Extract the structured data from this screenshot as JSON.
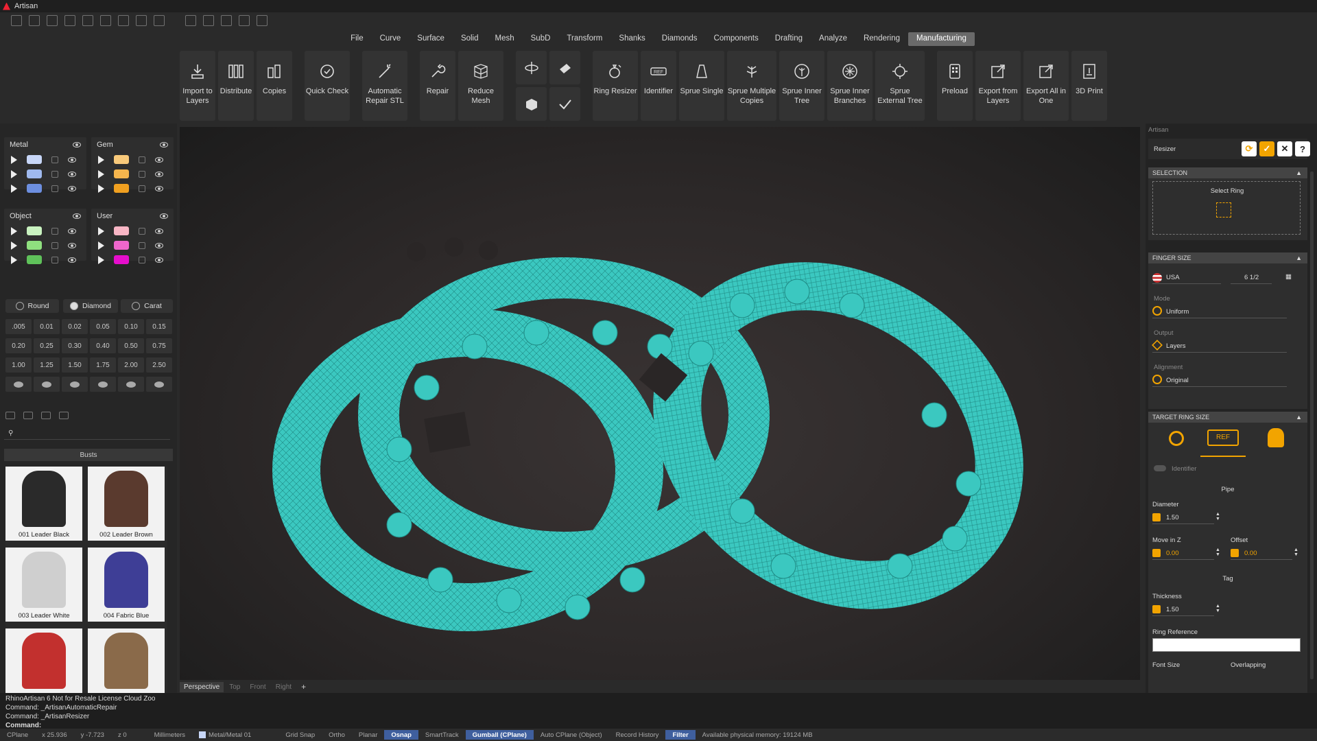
{
  "app": {
    "title": "Artisan"
  },
  "menu": [
    "File",
    "Curve",
    "Surface",
    "Solid",
    "Mesh",
    "SubD",
    "Transform",
    "Shanks",
    "Diamonds",
    "Components",
    "Drafting",
    "Analyze",
    "Rendering",
    "Manufacturing"
  ],
  "menu_active": "Manufacturing",
  "ribbon": {
    "import": "Import to Layers",
    "distribute": "Distribute",
    "copies": "Copies",
    "quick_check": "Quick Check",
    "auto_repair": "Automatic Repair STL",
    "repair": "Repair",
    "reduce_mesh": "Reduce Mesh",
    "ring_resizer": "Ring Resizer",
    "identifier": "Identifier",
    "sprue_single": "Sprue Single",
    "sprue_multiple": "Sprue Multiple Copies",
    "sprue_inner_tree": "Sprue Inner Tree",
    "sprue_inner_branches": "Sprue Inner Branches",
    "sprue_external_tree": "Sprue External Tree",
    "preload": "Preload",
    "export_layers": "Export from Layers",
    "export_all": "Export All in One",
    "print3d": "3D Print"
  },
  "layers": {
    "metal": {
      "label": "Metal",
      "colors": [
        "#c7d6f7",
        "#9fb9ee",
        "#6d8fe0"
      ]
    },
    "gem": {
      "label": "Gem",
      "colors": [
        "#f8c97a",
        "#f5b54d",
        "#f0a020"
      ]
    },
    "object": {
      "label": "Object",
      "colors": [
        "#c9f2c0",
        "#8fe07f",
        "#5fc25a"
      ]
    },
    "user": {
      "label": "User",
      "colors": [
        "#f8b6c5",
        "#ee66cc",
        "#e60ecc"
      ]
    }
  },
  "gems": {
    "round": "Round",
    "diamond": "Diamond",
    "carat": "Carat",
    "sizes": [
      ".005",
      "0.01",
      "0.02",
      "0.05",
      "0.10",
      "0.15",
      "0.20",
      "0.25",
      "0.30",
      "0.40",
      "0.50",
      "0.75",
      "1.00",
      "1.25",
      "1.50",
      "1.75",
      "2.00",
      "2.50"
    ]
  },
  "library": {
    "category": "Busts",
    "items": [
      {
        "label": "001 Leader Black",
        "color": "#2a2a2a"
      },
      {
        "label": "002 Leader Brown",
        "color": "#5a3a2e"
      },
      {
        "label": "003 Leader White",
        "color": "#cfcfcf"
      },
      {
        "label": "004 Fabric Blue",
        "color": "#3e3e96"
      },
      {
        "label": "",
        "color": "#c2302e"
      },
      {
        "label": "",
        "color": "#8a6a4a"
      }
    ]
  },
  "viewport": {
    "tabs": [
      "Perspective",
      "Top",
      "Front",
      "Right"
    ],
    "active_tab": "Perspective",
    "mesh_color": "#3bc8c0"
  },
  "panel": {
    "header": "Artisan",
    "tool": "Resizer",
    "selection_header": "SELECTION",
    "select_ring": "Select Ring",
    "finger_size_header": "FINGER SIZE",
    "country": "USA",
    "size": "6 1/2",
    "mode_label": "Mode",
    "mode": "Uniform",
    "output_label": "Output",
    "output": "Layers",
    "alignment_label": "Alignment",
    "alignment": "Original",
    "target_header": "TARGET RING SIZE",
    "identifier": "Identifier",
    "pipe": "Pipe",
    "diameter_label": "Diameter",
    "diameter": "1.50",
    "move_z_label": "Move in Z",
    "move_z": "0.00",
    "offset_label": "Offset",
    "offset": "0.00",
    "tag": "Tag",
    "thickness_label": "Thickness",
    "thickness": "1.50",
    "ring_ref_label": "Ring Reference",
    "font_size_label": "Font Size",
    "overlapping_label": "Overlapping"
  },
  "command": {
    "lines": [
      "RhinoArtisan 6 Not for Resale License Cloud Zoo",
      "Command: _ArtisanAutomaticRepair",
      "Command: _ArtisanResizer"
    ],
    "prompt": "Command:"
  },
  "status": {
    "cplane": "CPlane",
    "x": "x 25.936",
    "y": "y -7.723",
    "z": "z 0",
    "units": "Millimeters",
    "layer": "Metal/Metal 01",
    "grid_snap": "Grid Snap",
    "ortho": "Ortho",
    "planar": "Planar",
    "osnap": "Osnap",
    "smarttrack": "SmartTrack",
    "gumball": "Gumball (CPlane)",
    "auto_cplane": "Auto CPlane (Object)",
    "record_history": "Record History",
    "filter": "Filter",
    "memory": "Available physical memory: 19124 MB"
  },
  "colors": {
    "accent": "#f2a400",
    "mesh": "#3bc8c0"
  }
}
